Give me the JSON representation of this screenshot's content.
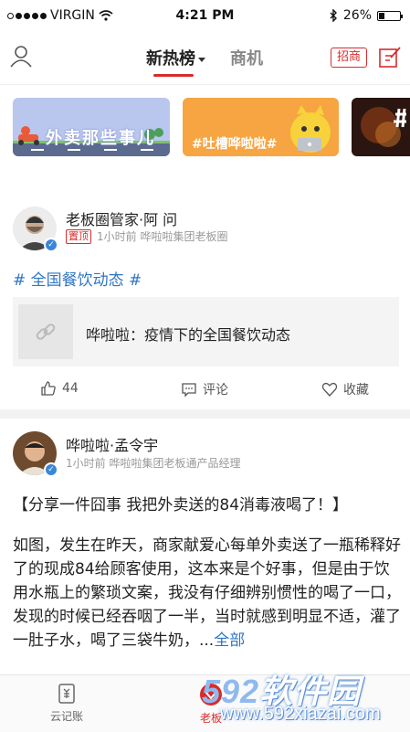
{
  "status_bar": {
    "carrier": "VIRGIN",
    "time": "4:21 PM",
    "battery_percent": "26%",
    "battery_level": 0.26,
    "signal_icon": "signal-dots-icon",
    "wifi_icon": "wifi-icon",
    "bluetooth_icon": "bluetooth-icon"
  },
  "nav": {
    "tab_hot": "新热榜",
    "tab_business": "商机",
    "recruit_label": "招商",
    "user_icon": "user-icon",
    "edit_icon": "compose-icon"
  },
  "banners": [
    {
      "text": "外卖那些事儿",
      "color": "#b9c6ee"
    },
    {
      "text": "#吐槽哗啦啦#",
      "color": "#f6a542"
    },
    {
      "text": "",
      "color": "#2a1510"
    }
  ],
  "posts": [
    {
      "author": "老板圈管家·阿 问",
      "pinned_label": "置顶",
      "meta": "1小时前 哗啦啦集团老板圈",
      "hashtag": "# 全国餐饮动态 #",
      "link_title": "哗啦啦：疫情下的全国餐饮动态",
      "likes": "44",
      "comment_label": "评论",
      "favorite_label": "收藏"
    },
    {
      "author": "哗啦啦·孟令宇",
      "meta": "1小时前 哗啦啦集团老板通产品经理",
      "headline": "【分享一件囧事 我把外卖送的84消毒液喝了！】",
      "body": "如图，发生在昨天，商家献爱心每单外卖送了一瓶稀释好了的现成84给顾客使用，这本来是个好事，但是由于饮用水瓶上的繁琐文案，我没有仔细辨别惯性的喝了一口，发现的时候已经吞咽了一半，当时就感到明显不适，灌了一肚子水，喝了三袋牛奶，...",
      "more_label": "全部"
    }
  ],
  "tabbar": {
    "items": [
      {
        "label": "云记账",
        "icon": "ledger-icon"
      },
      {
        "label": "老板",
        "icon": "boss-icon"
      }
    ]
  },
  "watermark": {
    "line1_num": "592",
    "line1_cn": "软件园",
    "line2": "www.592xiazai.com"
  },
  "colors": {
    "accent": "#d92b2b",
    "link": "#2f76c4"
  }
}
